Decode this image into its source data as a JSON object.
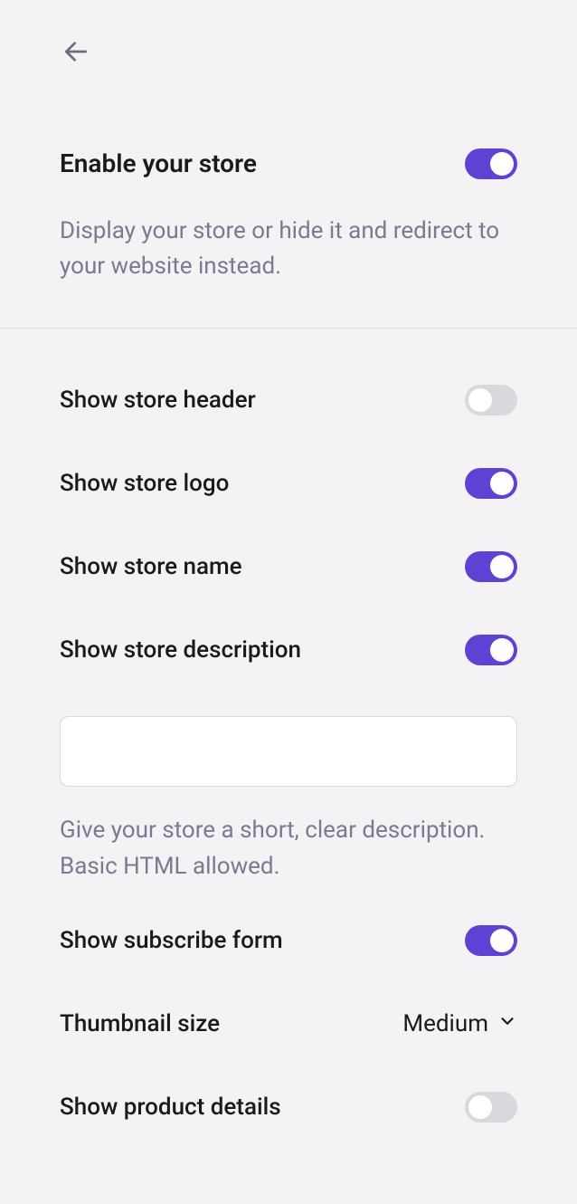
{
  "settings": {
    "enable": {
      "title": "Enable your store",
      "desc": "Display your store or hide it and redirect to your website instead.",
      "on": true
    },
    "header": {
      "label": "Show store header",
      "on": false
    },
    "logo": {
      "label": "Show store logo",
      "on": true
    },
    "name": {
      "label": "Show store name",
      "on": true
    },
    "description": {
      "label": "Show store description",
      "on": true,
      "value": "",
      "hint": "Give your store a short, clear description. Basic HTML allowed."
    },
    "subscribe": {
      "label": "Show subscribe form",
      "on": true
    },
    "thumbnail": {
      "label": "Thumbnail size",
      "value": "Medium"
    },
    "details": {
      "label": "Show product details",
      "on": false
    }
  }
}
